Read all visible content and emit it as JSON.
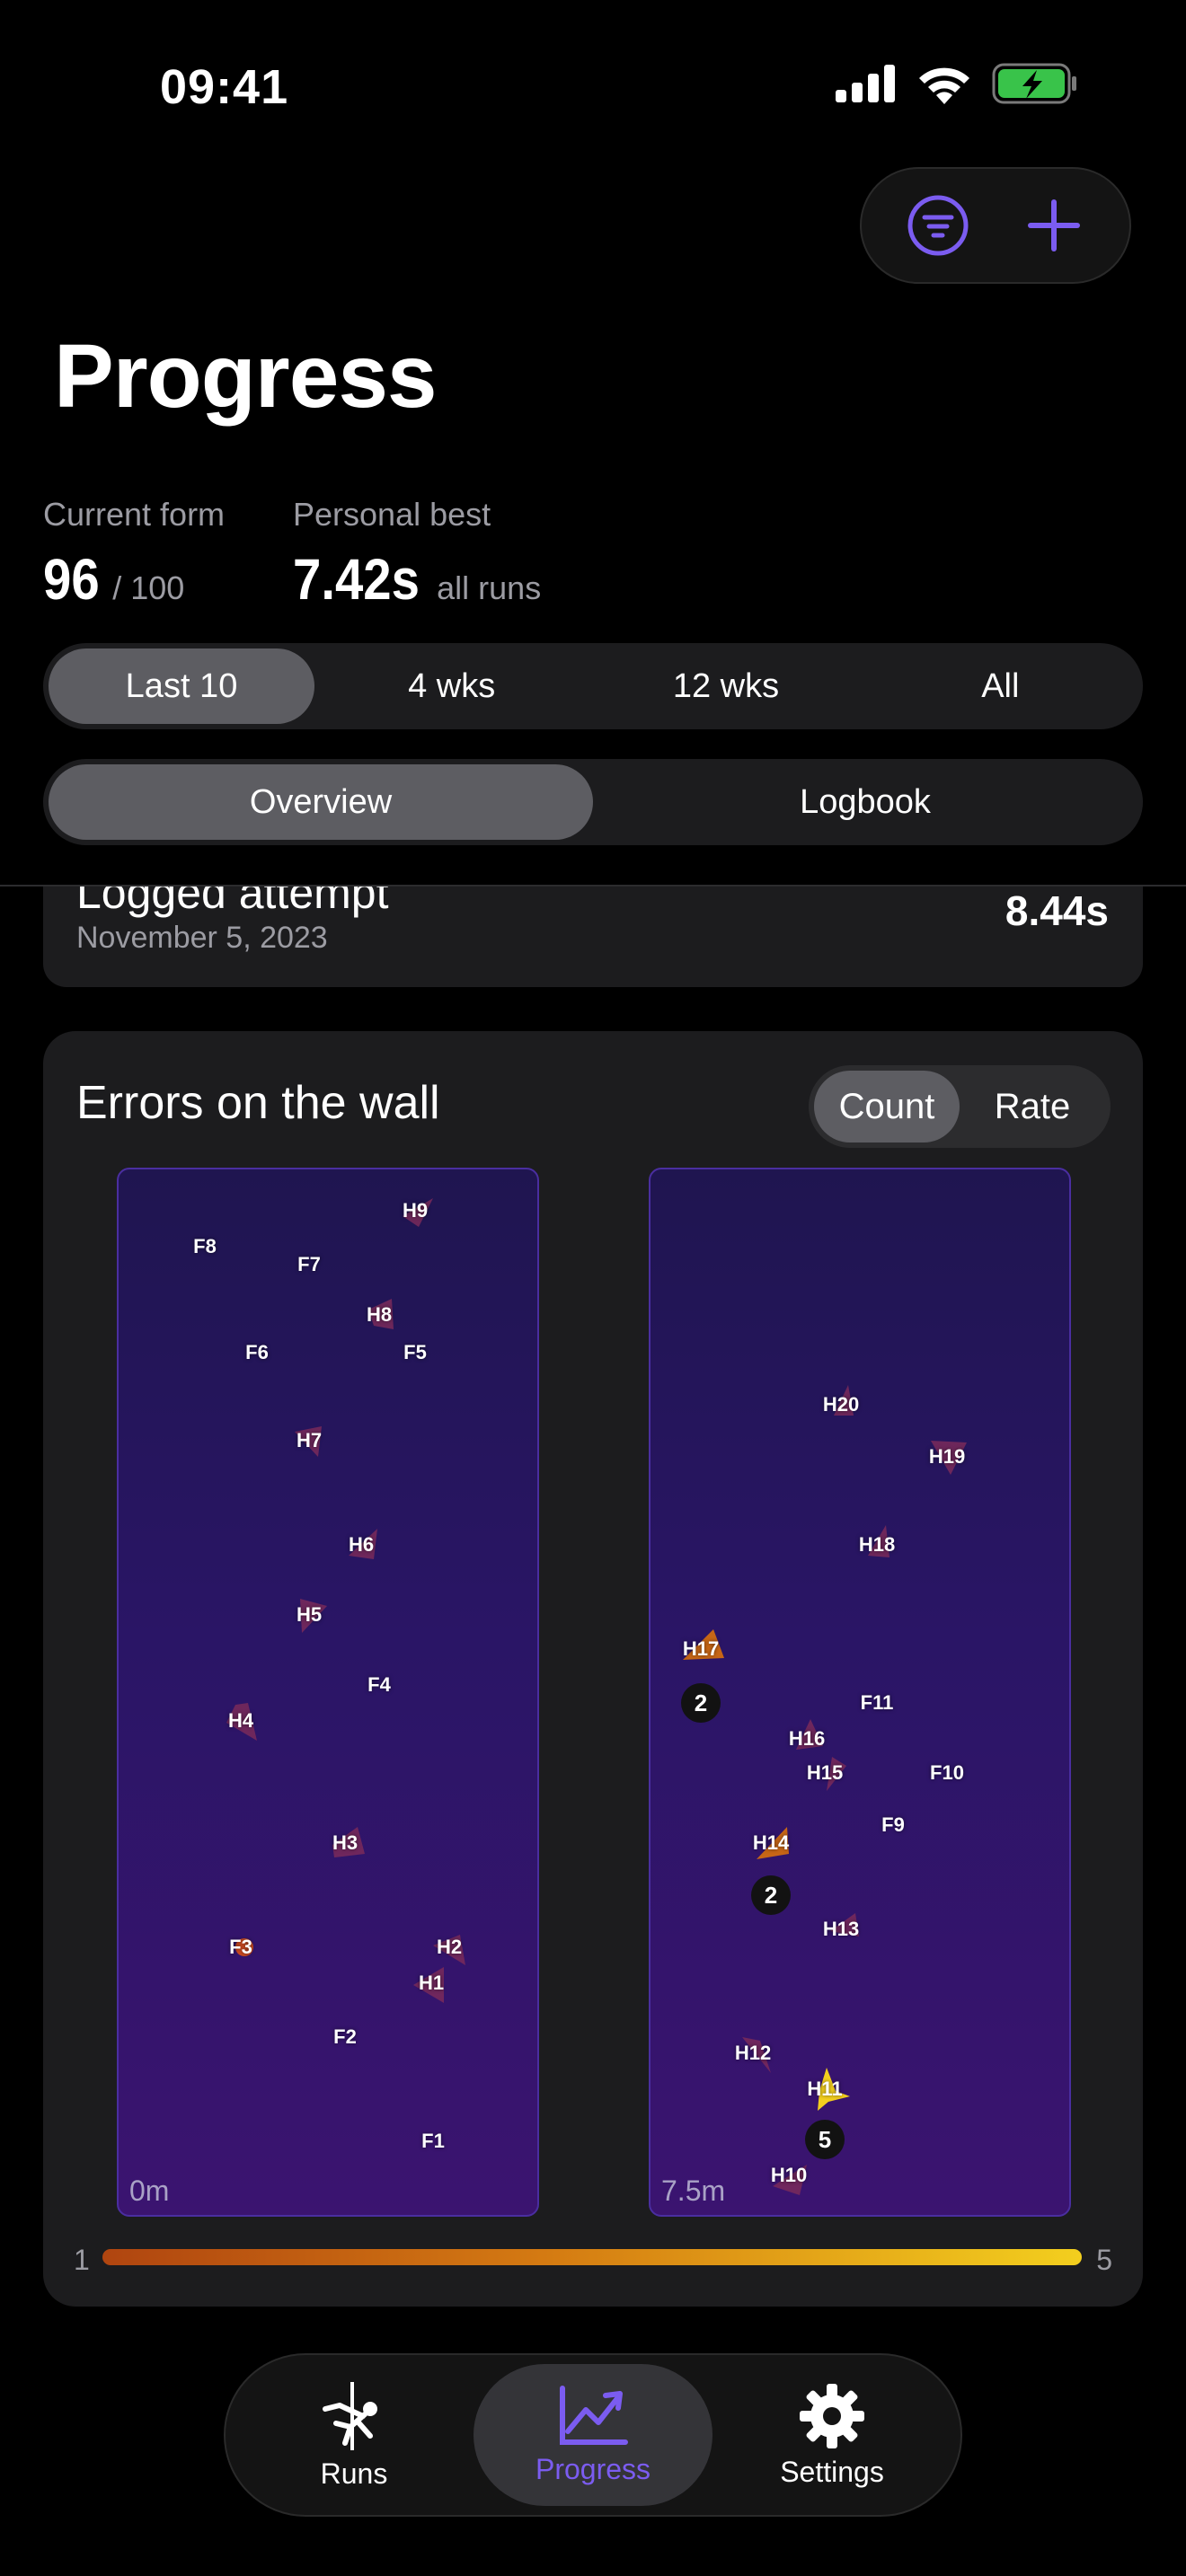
{
  "status_bar": {
    "time": "09:41"
  },
  "header": {
    "title": "Progress",
    "filter_icon": "filter-icon",
    "add_icon": "plus-icon"
  },
  "stats": {
    "current_form": {
      "label": "Current form",
      "value": "96",
      "suffix": "/ 100"
    },
    "personal_best": {
      "label": "Personal best",
      "value": "7.42s",
      "suffix": "all runs"
    }
  },
  "range_tabs": [
    "Last 10",
    "4 wks",
    "12 wks",
    "All"
  ],
  "view_tabs": [
    "Overview",
    "Logbook"
  ],
  "attempt": {
    "title": "Logged attempt",
    "date": "November 5, 2023",
    "time": "8.44s"
  },
  "errors": {
    "title": "Errors on the wall",
    "modes": [
      "Count",
      "Rate"
    ],
    "left_wall_start": "0m",
    "right_wall_start": "7.5m",
    "scale_min": "1",
    "scale_max": "5",
    "left_holds": [
      "H9",
      "F8",
      "F7",
      "H8",
      "F6",
      "F5",
      "H7",
      "H6",
      "H5",
      "F4",
      "H4",
      "H3",
      "F3",
      "H2",
      "H1",
      "F2",
      "F1"
    ],
    "right_holds": [
      "H20",
      "H19",
      "H18",
      "H17",
      "F11",
      "H16",
      "H15",
      "F10",
      "F9",
      "H14",
      "H13",
      "H12",
      "H11",
      "H10"
    ],
    "badges": [
      "2",
      "2",
      "5"
    ]
  },
  "colors": {
    "accent": "#7b5cf0",
    "error_high": "#f3cf1e",
    "error_low": "#b04510"
  },
  "tabbar": {
    "runs": "Runs",
    "progress": "Progress",
    "settings": "Settings"
  }
}
